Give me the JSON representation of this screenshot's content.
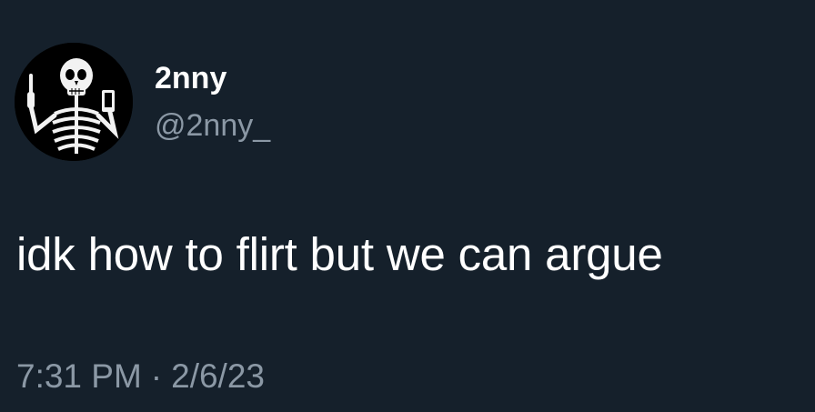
{
  "tweet": {
    "author": {
      "display_name": "2nny",
      "handle": "@2nny_",
      "avatar_icon": "skeleton-avatar-icon"
    },
    "text": "idk how to flirt but we can argue",
    "time": "7:31 PM",
    "separator": "·",
    "date": "2/6/23"
  },
  "colors": {
    "background": "#15202b",
    "primary_text": "#ffffff",
    "secondary_text": "#8b98a5"
  }
}
